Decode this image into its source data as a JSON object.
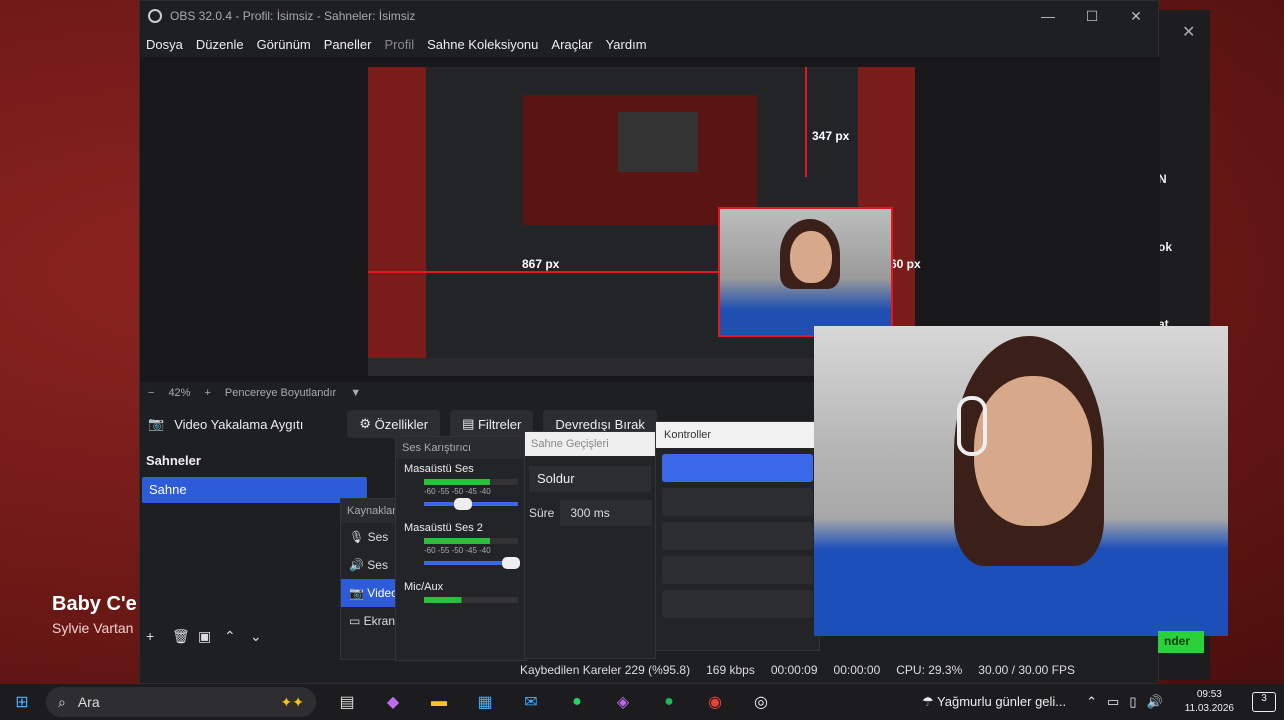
{
  "obs": {
    "title": "OBS 32.0.4 - Profil: İsimsiz - Sahneler: İsimsiz",
    "menu": [
      "Dosya",
      "Düzenle",
      "Görünüm",
      "Paneller",
      "Profil",
      "Sahne Koleksiyonu",
      "Araçlar",
      "Yardım"
    ],
    "preview_measure_top": "347 px",
    "preview_measure_left": "867 px",
    "preview_measure_right": "60 px",
    "zoom": {
      "minus": "−",
      "value": "42%",
      "plus": "+",
      "fit_label": "Pencereye Boyutlandır"
    },
    "source_bar": {
      "source_name": "Video Yakalama Aygıtı",
      "properties": "Özellikler",
      "filters": "Filtreler",
      "deactivate": "Devredışı Bırak"
    },
    "scenes": {
      "header": "Sahneler",
      "items": [
        "Sahne"
      ]
    },
    "sources": {
      "header": "Kaynaklar",
      "items": [
        "Ses",
        "Ses",
        "Video",
        "Ekran"
      ]
    },
    "mixer": {
      "header": "Ses Karıştırıcı",
      "channels": [
        {
          "name": "Masaüstü Ses",
          "ticks": "-60 -55 -50 -45 -40"
        },
        {
          "name": "Masaüstü Ses 2",
          "ticks": "-60 -55 -50 -45 -40"
        },
        {
          "name": "Mic/Aux"
        }
      ]
    },
    "transitions": {
      "header": "Sahne Geçişleri",
      "selected": "Soldur",
      "duration_label": "Süre",
      "duration_value": "300 ms"
    },
    "controls": {
      "header": "Kontroller"
    },
    "status": {
      "dropped": "Kaybedilen Kareler 229 (%95.8)",
      "bitrate": "169 kbps",
      "stream_time": "00:00:09",
      "rec_time": "00:00:00",
      "cpu": "CPU: 29.3%",
      "fps": "30.00 / 30.00 FPS"
    }
  },
  "desktop": {
    "bg_title": "Baby C'e",
    "bg_subtitle": "Sylvie Vartan",
    "side_letters": [
      "N",
      "ok",
      "at"
    ],
    "green_button": "nder"
  },
  "taskbar": {
    "search_placeholder": "Ara",
    "weather": "Yağmurlu günler geli...",
    "time": "09:53",
    "date": "11.03.2026",
    "notif_count": "3"
  }
}
